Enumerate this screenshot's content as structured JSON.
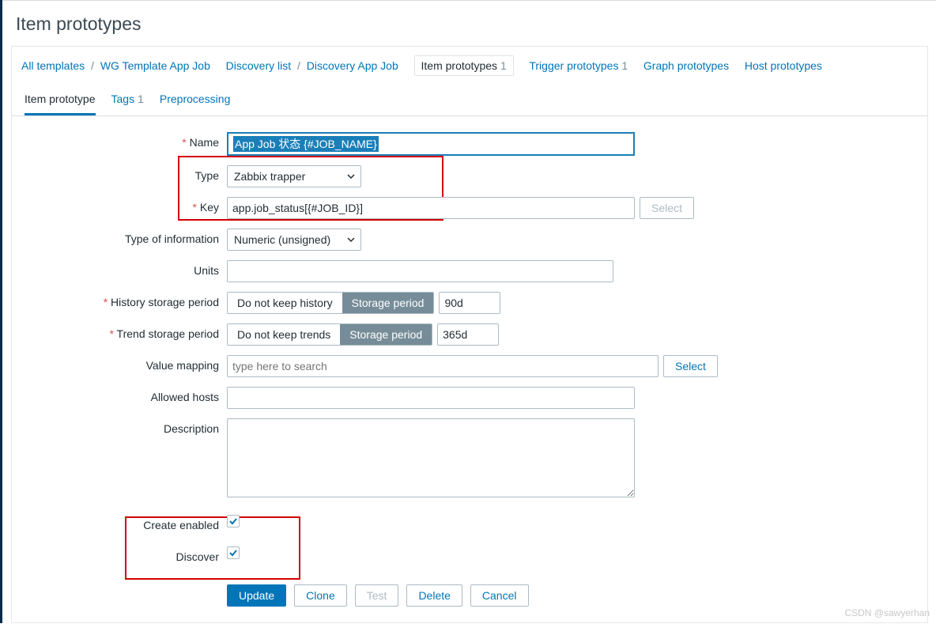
{
  "page_title": "Item prototypes",
  "breadcrumbs": {
    "all_templates": "All templates",
    "template": "WG Template App Job",
    "discovery_list": "Discovery list",
    "discovery_rule": "Discovery App Job",
    "item_prototypes_label": "Item prototypes",
    "item_prototypes_count": "1",
    "trigger_prototypes_label": "Trigger prototypes",
    "trigger_prototypes_count": "1",
    "graph_prototypes": "Graph prototypes",
    "host_prototypes": "Host prototypes"
  },
  "tabs": {
    "item": "Item prototype",
    "tags_label": "Tags",
    "tags_count": "1",
    "preprocessing": "Preprocessing"
  },
  "labels": {
    "name": "Name",
    "type": "Type",
    "key": "Key",
    "info": "Type of information",
    "units": "Units",
    "history": "History storage period",
    "trend": "Trend storage period",
    "vm": "Value mapping",
    "hosts": "Allowed hosts",
    "desc": "Description",
    "create_enabled": "Create enabled",
    "discover": "Discover"
  },
  "values": {
    "name": "App Job 状态 {#JOB_NAME}",
    "type": "Zabbix trapper",
    "key": "app.job_status[{#JOB_ID}]",
    "info": "Numeric (unsigned)",
    "units": "",
    "history_opt1": "Do not keep history",
    "history_opt2": "Storage period",
    "history_val": "90d",
    "trend_opt1": "Do not keep trends",
    "trend_opt2": "Storage period",
    "trend_val": "365d",
    "vm_placeholder": "type here to search",
    "hosts": "",
    "desc": ""
  },
  "buttons": {
    "select": "Select",
    "vm_select": "Select",
    "update": "Update",
    "clone": "Clone",
    "test": "Test",
    "delete": "Delete",
    "cancel": "Cancel"
  },
  "watermark": "CSDN @sawyerhan"
}
